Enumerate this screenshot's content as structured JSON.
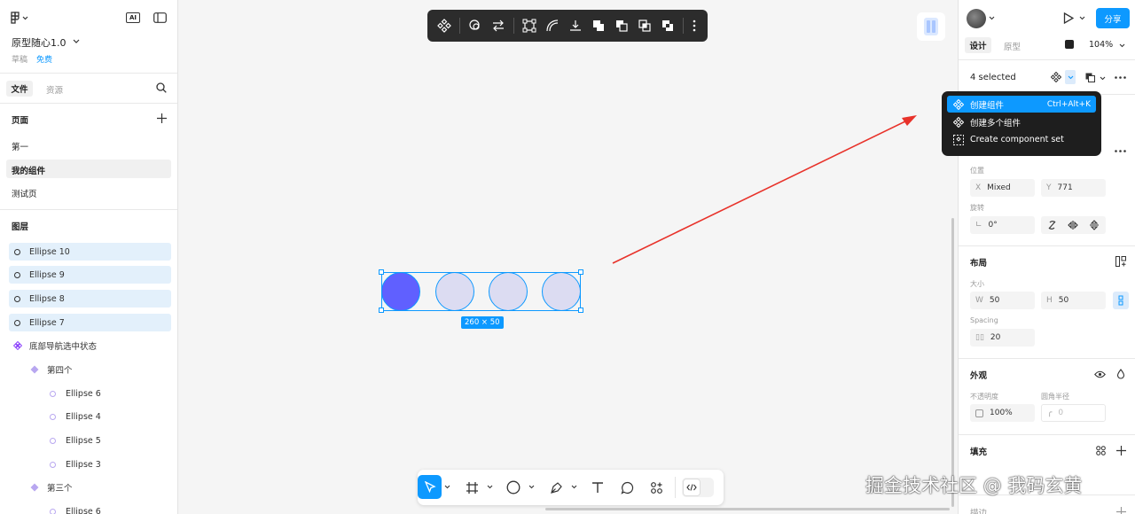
{
  "left_panel": {
    "file_title": "原型随心1.0",
    "status_draft": "草稿",
    "status_free": "免费",
    "tab_files": "文件",
    "tab_assets": "资源",
    "pages_header": "页面",
    "pages": [
      "第一",
      "我的组件",
      "测试页"
    ],
    "layers_header": "图层",
    "ai_badge": "AI",
    "layers": {
      "e10": "Ellipse 10",
      "e9": "Ellipse 9",
      "e8": "Ellipse 8",
      "e7": "Ellipse 7",
      "nav": "底部导航选中状态",
      "g4": "第四个",
      "e6": "Ellipse 6",
      "e4": "Ellipse 4",
      "e5": "Ellipse 5",
      "e3": "Ellipse 3",
      "g3": "第三个",
      "e6b": "Ellipse 6"
    }
  },
  "canvas": {
    "size_badge": "260 × 50"
  },
  "right_panel": {
    "share": "分享",
    "tab_design": "设计",
    "tab_prototype": "原型",
    "zoom": "104%",
    "selection": "4 selected",
    "position_label": "位置",
    "x_label": "X",
    "x_value": "Mixed",
    "y_label": "Y",
    "y_value": "771",
    "rotation_label": "旋转",
    "rotation_value": "0°",
    "layout_header": "布局",
    "size_label": "大小",
    "w_label": "W",
    "w_value": "50",
    "h_label": "H",
    "h_value": "50",
    "spacing_label": "Spacing",
    "spacing_value": "20",
    "appearance_header": "外观",
    "opacity_label": "不透明度",
    "radius_label": "圆角半径",
    "opacity_value": "100%",
    "radius_value": "0",
    "fill_header": "填充",
    "stroke_header": "描边"
  },
  "context_menu": {
    "item1": "创建组件",
    "item1_shortcut": "Ctrl+Alt+K",
    "item2": "创建多个组件",
    "item3": "Create component set"
  },
  "watermark": "掘金技术社区 @ 我码玄黄",
  "colors": {
    "accent": "#0d99ff",
    "ellipse_fill": "#6060ff",
    "ellipse_light": "#dcdcf2",
    "arrow": "#e8322a"
  }
}
